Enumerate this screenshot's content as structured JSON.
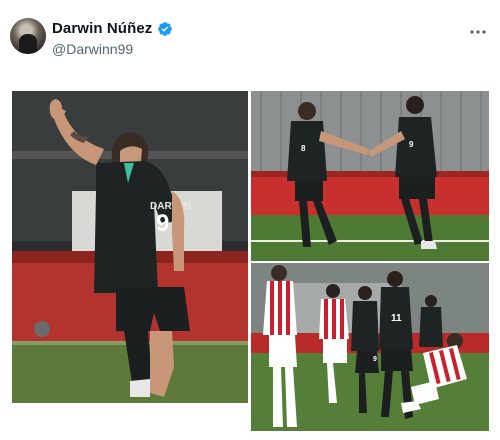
{
  "tweet": {
    "author": {
      "display_name": "Darwin Núñez",
      "handle": "@Darwinn99",
      "verified": true,
      "avatar_icon": "user-avatar"
    },
    "more_icon": "more-horizontal-icon",
    "media": [
      {
        "icon": "photo-player-thumbs-up",
        "shirt_name": "DARWIN",
        "shirt_number": "9"
      },
      {
        "icon": "photo-players-handshake",
        "shirt_numbers": [
          "8",
          "9"
        ]
      },
      {
        "icon": "photo-match-action",
        "shirt_numbers": [
          "11",
          "9"
        ]
      }
    ],
    "colors": {
      "accent": "#1d9bf0",
      "kit_dark": "#1e2424",
      "kit_accent": "#3fbfa0",
      "opponent_red": "#c8202f"
    }
  }
}
